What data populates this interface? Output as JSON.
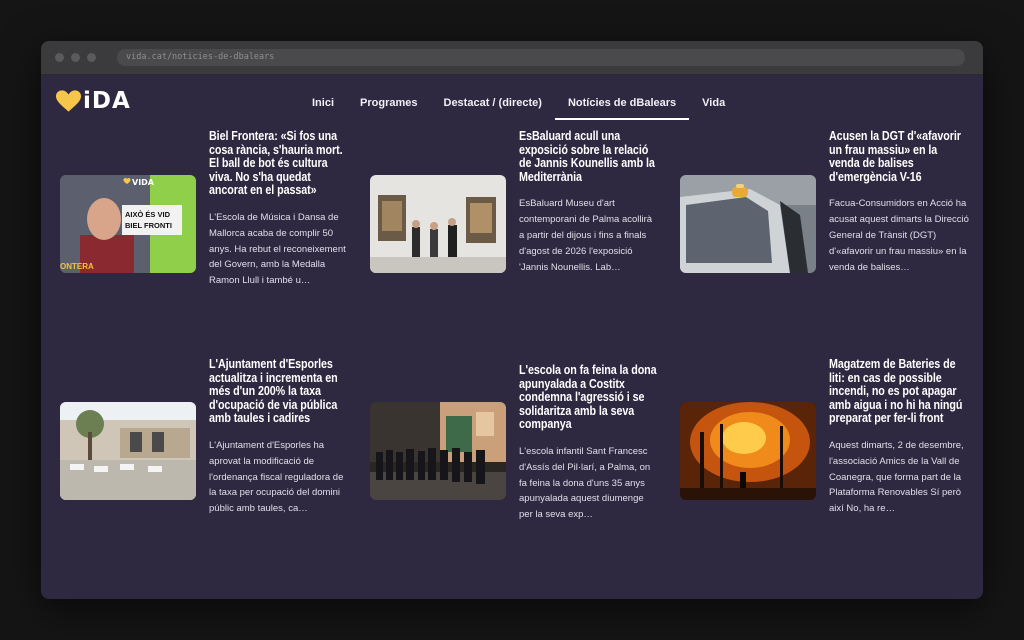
{
  "browser": {
    "url": "vida.cat/noticies-de-dbalears"
  },
  "logo": {
    "text": "iDA",
    "heart_color": "#f5c64a"
  },
  "nav": {
    "items": [
      {
        "label": "Inici"
      },
      {
        "label": "Programes"
      },
      {
        "label": "Destacat / (directe)"
      },
      {
        "label": "Notícies de dBalears",
        "active": true
      },
      {
        "label": "Vida"
      }
    ]
  },
  "articles": [
    {
      "title": "Biel Frontera: «Si fos una cosa rància, s'hauria mort. El ball de bot és cultura viva. No s'ha quedat ancorat en el passat»",
      "excerpt": "L'Escola de Música i Dansa de Mallorca acaba de complir 50 anys. Ha rebut el reconeixement del Govern, amb la Medalla Ramon Llull i també u…",
      "image": {
        "icon": "tv-interview-photo",
        "overlay_brand": "VIDA",
        "overlay_line1": "AIXÒ ÉS VID",
        "overlay_line2": "BIEL FRONTI",
        "overlay_name": "ONTERA"
      }
    },
    {
      "title": "EsBaluard acull una exposició sobre la relació de Jannis Kounellis amb la Mediterrània",
      "excerpt": "EsBaluard Museu d'art contemporani de Palma acollirà a partir del dijous i fins a finals d'agost de 2026 l'exposició 'Jannis Nounellis. Lab…",
      "image": {
        "icon": "gallery-photo"
      }
    },
    {
      "title": "Acusen la DGT d'«afavorir un frau massiu» en la venda de balises d'emergència V-16",
      "excerpt": "Facua-Consumidors en Acció ha acusat aquest dimarts la Direcció General de Trànsit (DGT) d'«afavorir un frau massiu» en la venda de balises…",
      "image": {
        "icon": "car-beacon-photo"
      }
    },
    {
      "title": "L'Ajuntament d'Esporles actualitza i incrementa en més d'un 200% la taxa d'ocupació de via pública amb taules i cadires",
      "excerpt": "L'Ajuntament d'Esporles ha aprovat la modificació de l'ordenança fiscal reguladora de la taxa per ocupació del domini públic amb taules, ca…",
      "image": {
        "icon": "terrace-photo"
      }
    },
    {
      "title": "L'escola on fa feina la dona apunyalada a Costitx condemna l'agressió i se solidaritza amb la seva companya",
      "excerpt": "L'escola infantil Sant Francesc d'Assís del Pil·larí, a Palma, on fa feina la dona d'uns 35 anys apunyalada aquest diumenge per la seva exp…",
      "image": {
        "icon": "street-crowd-photo"
      }
    },
    {
      "title": "Magatzem de Bateries de liti: en cas de possible incendi, no es pot apagar amb aigua i no hi ha ningú preparat per fer-li front",
      "excerpt": "Aquest dimarts, 2 de desembre, l'associació Amics de la Vall de Coanegra, que forma part de la Plataforma Renovables Sí però així No, ha re…",
      "image": {
        "icon": "fire-photo"
      }
    }
  ]
}
